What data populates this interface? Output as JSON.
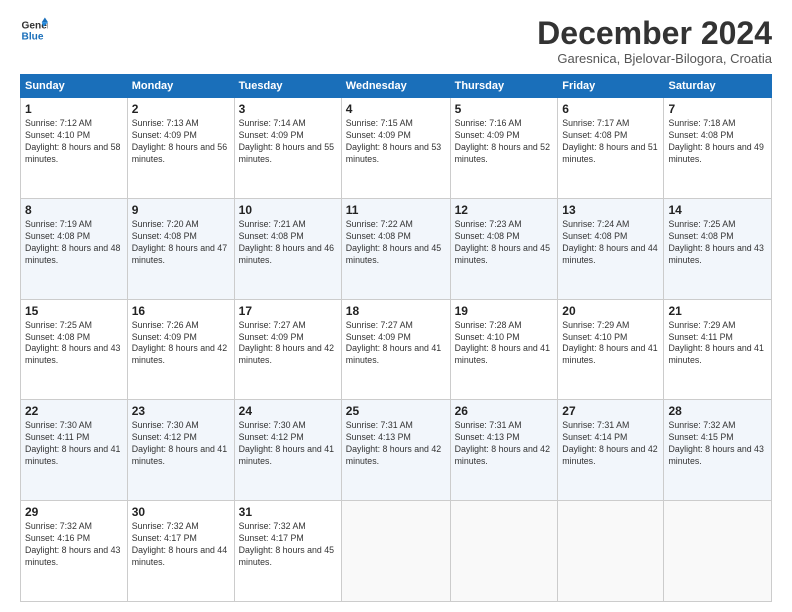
{
  "header": {
    "logo_line1": "General",
    "logo_line2": "Blue",
    "month_title": "December 2024",
    "subtitle": "Garesnica, Bjelovar-Bilogora, Croatia"
  },
  "days_of_week": [
    "Sunday",
    "Monday",
    "Tuesday",
    "Wednesday",
    "Thursday",
    "Friday",
    "Saturday"
  ],
  "weeks": [
    [
      {
        "day": "1",
        "sunrise": "7:12 AM",
        "sunset": "4:10 PM",
        "daylight": "8 hours and 58 minutes."
      },
      {
        "day": "2",
        "sunrise": "7:13 AM",
        "sunset": "4:09 PM",
        "daylight": "8 hours and 56 minutes."
      },
      {
        "day": "3",
        "sunrise": "7:14 AM",
        "sunset": "4:09 PM",
        "daylight": "8 hours and 55 minutes."
      },
      {
        "day": "4",
        "sunrise": "7:15 AM",
        "sunset": "4:09 PM",
        "daylight": "8 hours and 53 minutes."
      },
      {
        "day": "5",
        "sunrise": "7:16 AM",
        "sunset": "4:09 PM",
        "daylight": "8 hours and 52 minutes."
      },
      {
        "day": "6",
        "sunrise": "7:17 AM",
        "sunset": "4:08 PM",
        "daylight": "8 hours and 51 minutes."
      },
      {
        "day": "7",
        "sunrise": "7:18 AM",
        "sunset": "4:08 PM",
        "daylight": "8 hours and 49 minutes."
      }
    ],
    [
      {
        "day": "8",
        "sunrise": "7:19 AM",
        "sunset": "4:08 PM",
        "daylight": "8 hours and 48 minutes."
      },
      {
        "day": "9",
        "sunrise": "7:20 AM",
        "sunset": "4:08 PM",
        "daylight": "8 hours and 47 minutes."
      },
      {
        "day": "10",
        "sunrise": "7:21 AM",
        "sunset": "4:08 PM",
        "daylight": "8 hours and 46 minutes."
      },
      {
        "day": "11",
        "sunrise": "7:22 AM",
        "sunset": "4:08 PM",
        "daylight": "8 hours and 45 minutes."
      },
      {
        "day": "12",
        "sunrise": "7:23 AM",
        "sunset": "4:08 PM",
        "daylight": "8 hours and 45 minutes."
      },
      {
        "day": "13",
        "sunrise": "7:24 AM",
        "sunset": "4:08 PM",
        "daylight": "8 hours and 44 minutes."
      },
      {
        "day": "14",
        "sunrise": "7:25 AM",
        "sunset": "4:08 PM",
        "daylight": "8 hours and 43 minutes."
      }
    ],
    [
      {
        "day": "15",
        "sunrise": "7:25 AM",
        "sunset": "4:08 PM",
        "daylight": "8 hours and 43 minutes."
      },
      {
        "day": "16",
        "sunrise": "7:26 AM",
        "sunset": "4:09 PM",
        "daylight": "8 hours and 42 minutes."
      },
      {
        "day": "17",
        "sunrise": "7:27 AM",
        "sunset": "4:09 PM",
        "daylight": "8 hours and 42 minutes."
      },
      {
        "day": "18",
        "sunrise": "7:27 AM",
        "sunset": "4:09 PM",
        "daylight": "8 hours and 41 minutes."
      },
      {
        "day": "19",
        "sunrise": "7:28 AM",
        "sunset": "4:10 PM",
        "daylight": "8 hours and 41 minutes."
      },
      {
        "day": "20",
        "sunrise": "7:29 AM",
        "sunset": "4:10 PM",
        "daylight": "8 hours and 41 minutes."
      },
      {
        "day": "21",
        "sunrise": "7:29 AM",
        "sunset": "4:11 PM",
        "daylight": "8 hours and 41 minutes."
      }
    ],
    [
      {
        "day": "22",
        "sunrise": "7:30 AM",
        "sunset": "4:11 PM",
        "daylight": "8 hours and 41 minutes."
      },
      {
        "day": "23",
        "sunrise": "7:30 AM",
        "sunset": "4:12 PM",
        "daylight": "8 hours and 41 minutes."
      },
      {
        "day": "24",
        "sunrise": "7:30 AM",
        "sunset": "4:12 PM",
        "daylight": "8 hours and 41 minutes."
      },
      {
        "day": "25",
        "sunrise": "7:31 AM",
        "sunset": "4:13 PM",
        "daylight": "8 hours and 42 minutes."
      },
      {
        "day": "26",
        "sunrise": "7:31 AM",
        "sunset": "4:13 PM",
        "daylight": "8 hours and 42 minutes."
      },
      {
        "day": "27",
        "sunrise": "7:31 AM",
        "sunset": "4:14 PM",
        "daylight": "8 hours and 42 minutes."
      },
      {
        "day": "28",
        "sunrise": "7:32 AM",
        "sunset": "4:15 PM",
        "daylight": "8 hours and 43 minutes."
      }
    ],
    [
      {
        "day": "29",
        "sunrise": "7:32 AM",
        "sunset": "4:16 PM",
        "daylight": "8 hours and 43 minutes."
      },
      {
        "day": "30",
        "sunrise": "7:32 AM",
        "sunset": "4:17 PM",
        "daylight": "8 hours and 44 minutes."
      },
      {
        "day": "31",
        "sunrise": "7:32 AM",
        "sunset": "4:17 PM",
        "daylight": "8 hours and 45 minutes."
      },
      null,
      null,
      null,
      null
    ]
  ],
  "labels": {
    "sunrise": "Sunrise:",
    "sunset": "Sunset:",
    "daylight": "Daylight:"
  }
}
